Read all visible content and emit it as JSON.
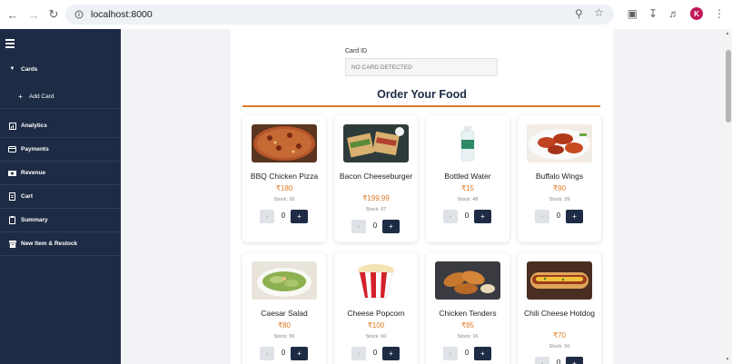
{
  "browser": {
    "url": "localhost:8000",
    "profile_initial": "K"
  },
  "sidebar": {
    "items": [
      {
        "label": "Cards",
        "icon": "chevron-down-icon"
      },
      {
        "label": "Add Card",
        "icon": "plus-icon"
      },
      {
        "label": "Analytics",
        "icon": "analytics-icon"
      },
      {
        "label": "Payments",
        "icon": "credit-card-icon"
      },
      {
        "label": "Revenue",
        "icon": "money-icon"
      },
      {
        "label": "Cart",
        "icon": "document-icon"
      },
      {
        "label": "Summary",
        "icon": "clipboard-icon"
      },
      {
        "label": "New Item & Restock",
        "icon": "box-icon"
      }
    ]
  },
  "main": {
    "card_id_label": "Card ID",
    "card_id_value": "NO CARD DETECTED",
    "order_title": "Order Your Food",
    "foods": [
      {
        "name": "BBQ Chicken Pizza",
        "price": "₹180",
        "stock": "Stock: 30",
        "qty": "0",
        "img": "pizza"
      },
      {
        "name": "Bacon Cheeseburger",
        "price": "₹199.99",
        "stock": "Stock: 67",
        "qty": "0",
        "img": "burger"
      },
      {
        "name": "Bottled Water",
        "price": "₹15",
        "stock": "Stock: 48",
        "qty": "0",
        "img": "water"
      },
      {
        "name": "Buffalo Wings",
        "price": "₹90",
        "stock": "Stock: 39",
        "qty": "0",
        "img": "wings"
      },
      {
        "name": "Caesar Salad",
        "price": "₹80",
        "stock": "Stock: 56",
        "qty": "0",
        "img": "salad"
      },
      {
        "name": "Cheese Popcorn",
        "price": "₹100",
        "stock": "Stock: 60",
        "qty": "0",
        "img": "popcorn"
      },
      {
        "name": "Chicken Tenders",
        "price": "₹85",
        "stock": "Stock: 16",
        "qty": "0",
        "img": "tenders"
      },
      {
        "name": "Chili Cheese Hotdog",
        "price": "₹70",
        "stock": "Stock: 50",
        "qty": "0",
        "img": "hotdog"
      }
    ],
    "minus_label": "-",
    "plus_label": "+"
  },
  "colors": {
    "sidebar_bg": "#1e2b45",
    "accent_orange": "#e07b24",
    "plus_button": "#1e2b45"
  }
}
